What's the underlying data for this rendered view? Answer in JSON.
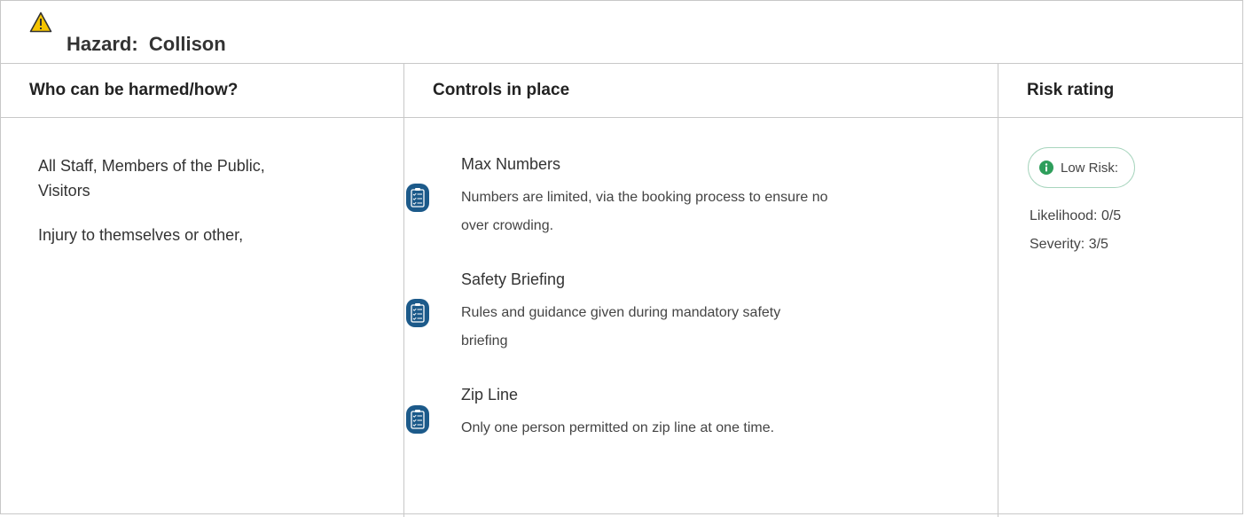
{
  "hazard": {
    "label": "Hazard:  Collison",
    "icon": "warning-triangle-icon",
    "icon_color": "#f5c400"
  },
  "columns": {
    "who": "Who can be harmed/how?",
    "controls": "Controls in place",
    "risk": "Risk rating"
  },
  "who": {
    "people": "All Staff, Members of the Public,",
    "people_cont": "Visitors",
    "harm": "Injury to themselves or other,"
  },
  "controls": [
    {
      "icon": "rules-clipboard-icon",
      "title": "Max Numbers",
      "desc_line1": "Numbers are limited, via the booking process to ensure no",
      "desc_line2": "over crowding."
    },
    {
      "icon": "rules-clipboard-icon",
      "title": "Safety Briefing",
      "desc_line1": "Rules and guidance given during mandatory safety",
      "desc_line2": "briefing"
    },
    {
      "icon": "rules-clipboard-icon",
      "title": "Zip Line",
      "desc_line1": "Only one person permitted on zip line at one time.",
      "desc_line2": ""
    }
  ],
  "risk": {
    "badge_label": "Low Risk:",
    "badge_icon": "info-circle-icon",
    "badge_color": "#2e9e5b",
    "likelihood": "Likelihood: 0/5",
    "severity": "Severity: 3/5"
  },
  "colors": {
    "icon_blue": "#1c5a8a",
    "border": "#c8c8c8"
  }
}
